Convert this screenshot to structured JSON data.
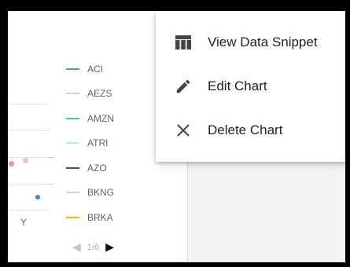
{
  "chart_card": {
    "x_axis_label": "Y",
    "legend": [
      {
        "label": "ACI",
        "color": "#5b8def"
      },
      {
        "label": "AEZS",
        "color": "#c3d7f7"
      },
      {
        "label": "AMZN",
        "color": "#3ecf9a"
      },
      {
        "label": "ATRI",
        "color": "#bcebd9"
      },
      {
        "label": "AZO",
        "color": "#3d4f7c"
      },
      {
        "label": "BKNG",
        "color": "#d1d1dc"
      },
      {
        "label": "BRKA",
        "color": "#f5b800"
      }
    ],
    "pager": {
      "prev_icon": "triangle-left-icon",
      "count": "1/6",
      "next_icon": "triangle-right-icon"
    }
  },
  "context_menu": {
    "items": [
      {
        "label": "View Data Snippet",
        "icon": "table-icon"
      },
      {
        "label": "Edit Chart",
        "icon": "pencil-icon"
      },
      {
        "label": "Delete Chart",
        "icon": "close-icon"
      }
    ]
  },
  "colors": {
    "dot_pink": "#f48fb1",
    "dot_pink_light": "#f8bbd0",
    "dot_blue": "#3b82f6"
  }
}
